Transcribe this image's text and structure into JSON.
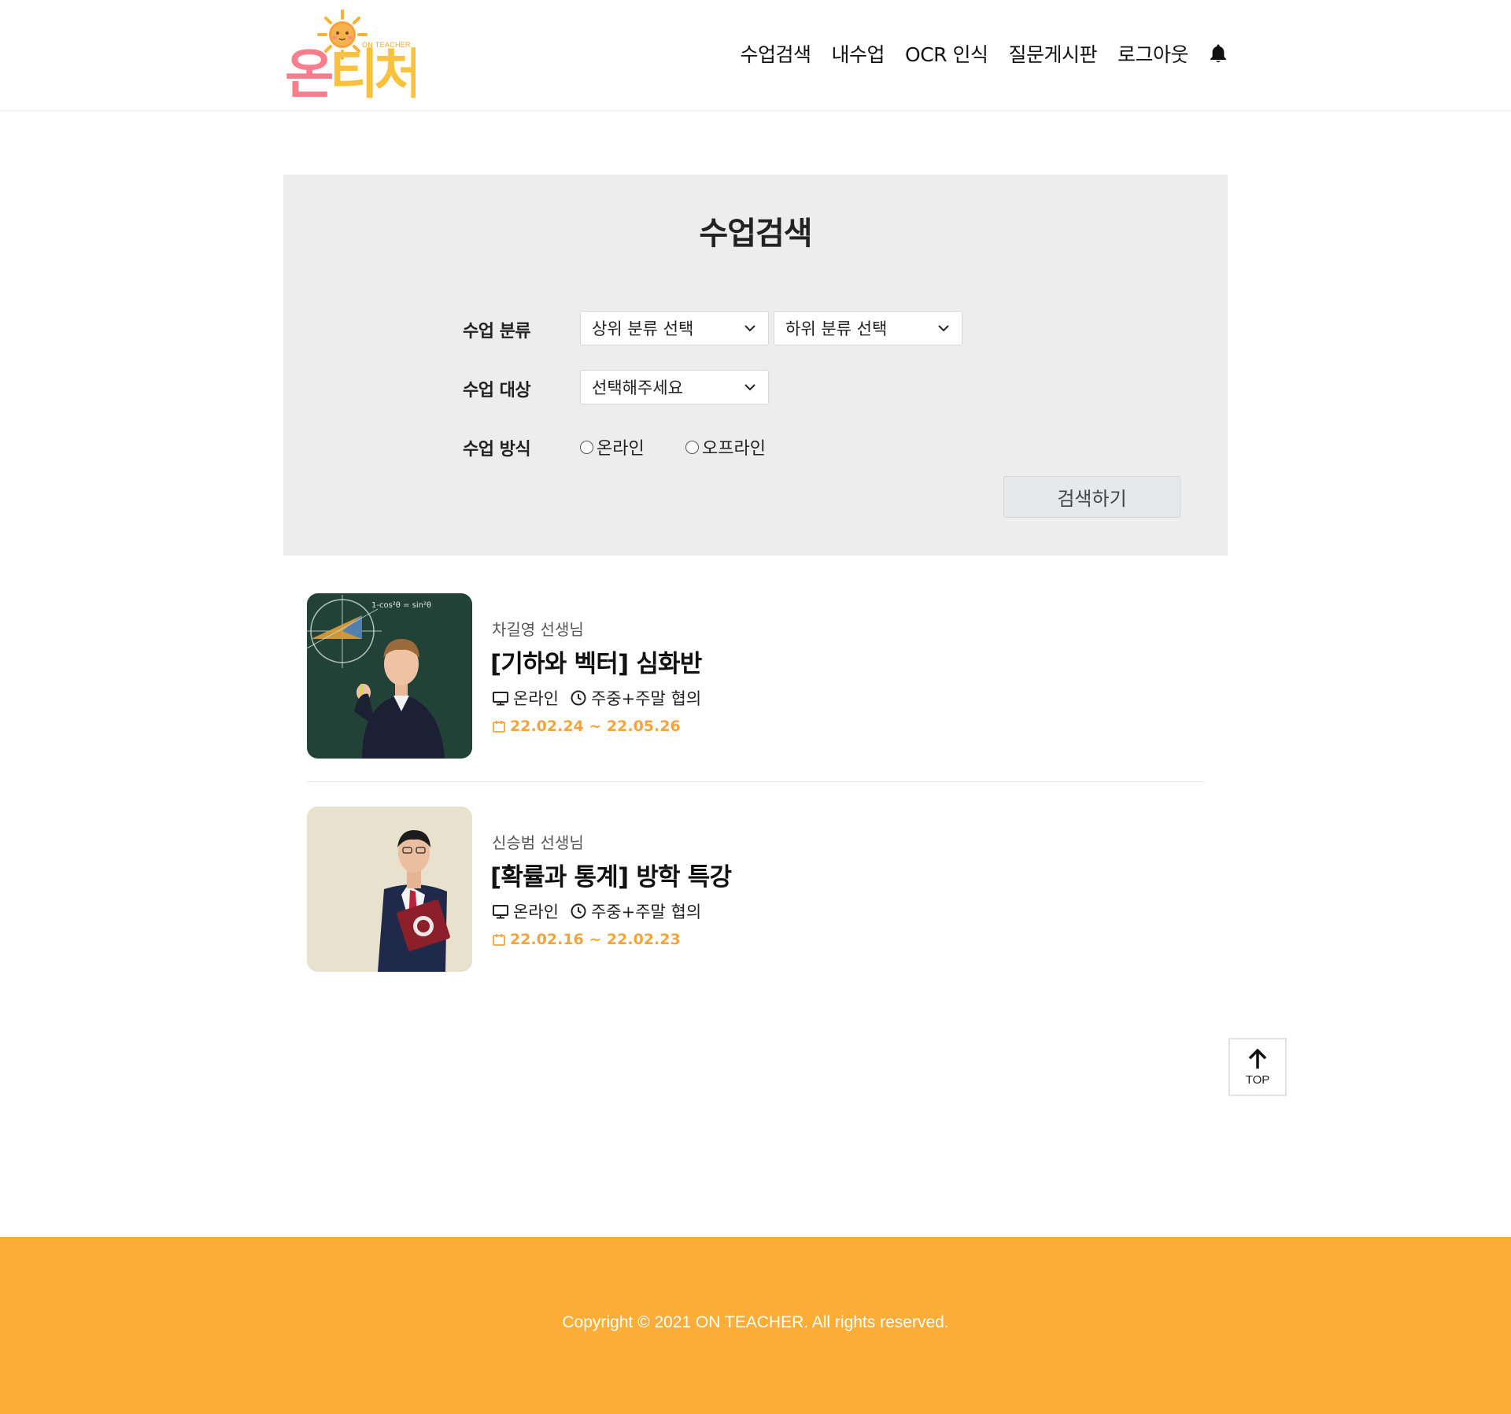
{
  "logo": {
    "text_ko": "온티처",
    "text_en": "ON TEACHER"
  },
  "nav": {
    "items": [
      {
        "label": "수업검색"
      },
      {
        "label": "내수업"
      },
      {
        "label": "OCR 인식"
      },
      {
        "label": "질문게시판"
      },
      {
        "label": "로그아웃"
      }
    ],
    "bell_icon": "bell-icon"
  },
  "search": {
    "title": "수업검색",
    "category_label": "수업 분류",
    "upper_category": "상위 분류 선택",
    "lower_category": "하위 분류 선택",
    "target_label": "수업 대상",
    "target_value": "선택해주세요",
    "method_label": "수업 방식",
    "method_options": [
      "온라인",
      "오프라인"
    ],
    "submit_label": "검색하기"
  },
  "courses": [
    {
      "teacher": "차길영 선생님",
      "title": "[기하와 벡터] 심화반",
      "mode": "온라인",
      "schedule": "주중+주말 협의",
      "dates": "22.02.24 ~ 22.05.26",
      "blackboard_text": "1-cos²θ = sin²θ"
    },
    {
      "teacher": "신승범 선생님",
      "title": "[확률과 통계] 방학 특강",
      "mode": "온라인",
      "schedule": "주중+주말 협의",
      "dates": "22.02.16 ~ 22.02.23"
    }
  ],
  "top_button": {
    "label": "TOP"
  },
  "footer": {
    "copyright": "Copyright © 2021 ON TEACHER. All rights reserved."
  },
  "colors": {
    "accent": "#fbad38",
    "date_text": "#f6a33b",
    "panel_bg": "#ededed",
    "logo_pink": "#f87e8e",
    "logo_yellow": "#f9c23c"
  }
}
